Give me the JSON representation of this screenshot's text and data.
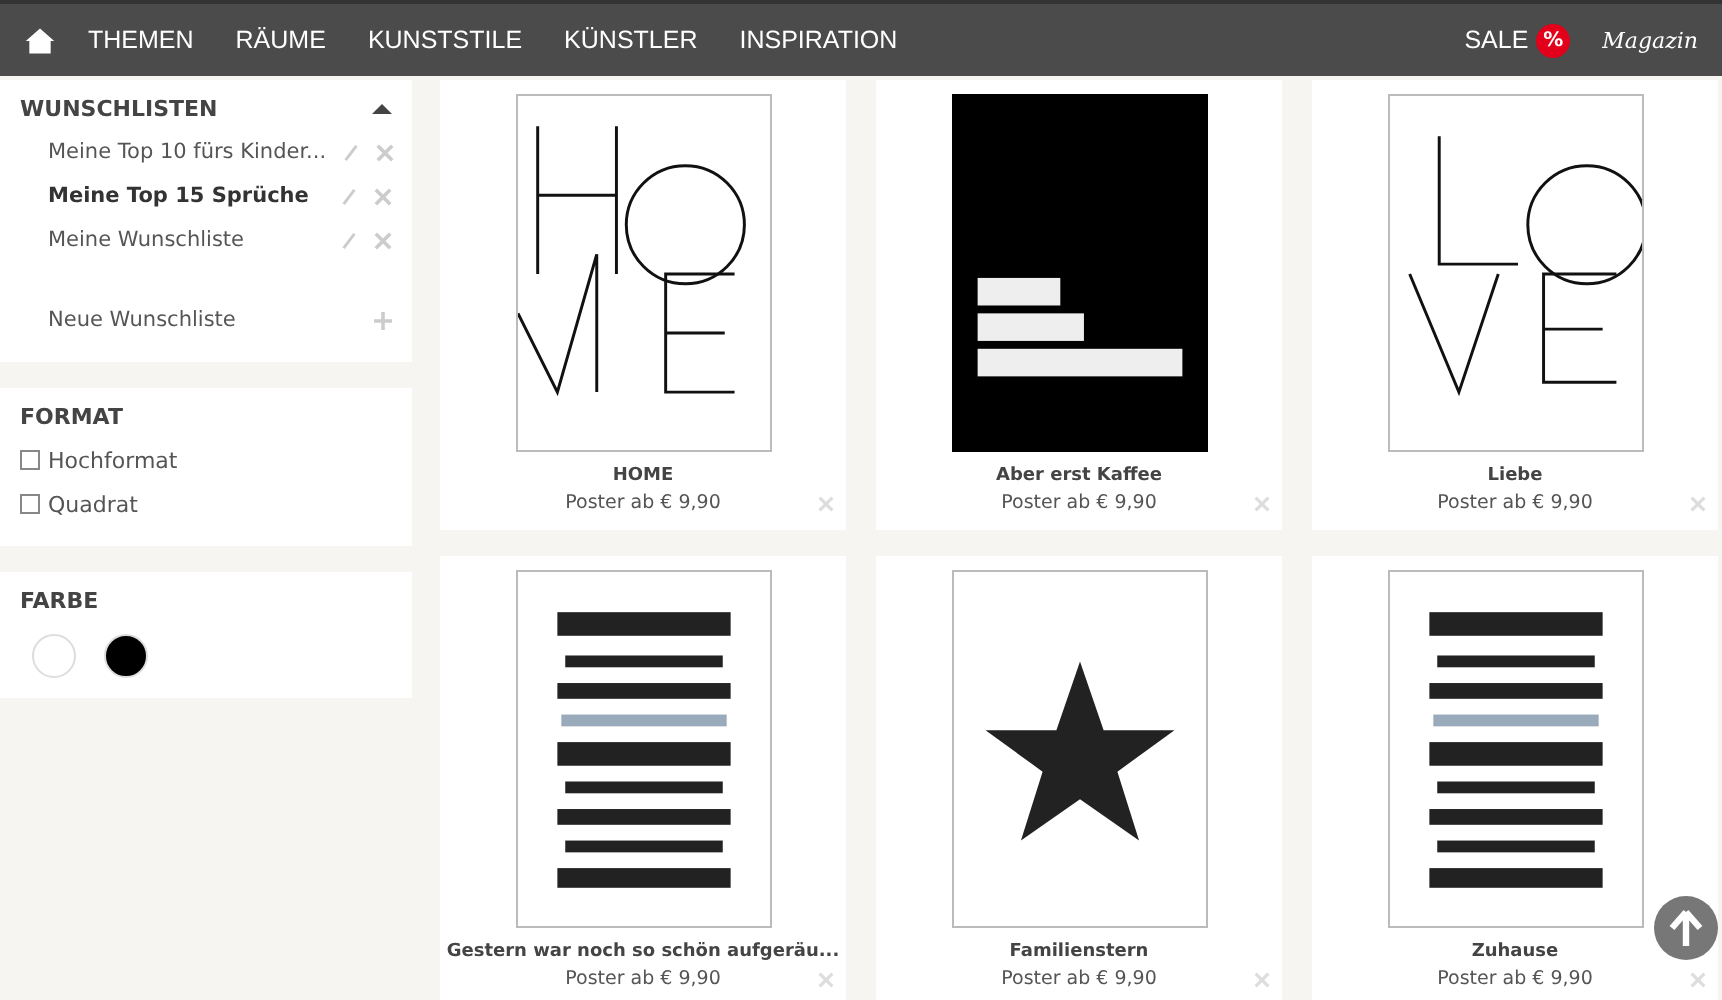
{
  "nav": {
    "items": [
      "THEMEN",
      "RÄUME",
      "KUNSTSTILE",
      "KÜNSTLER",
      "INSPIRATION"
    ],
    "sale": "SALE",
    "sale_badge": "%",
    "magazine": "Magazin"
  },
  "wishlists": {
    "title": "WUNSCHLISTEN",
    "expanded": true,
    "items": [
      {
        "label": "Meine Top 10 fürs Kinder...",
        "selected": false
      },
      {
        "label": "Meine Top 15 Sprüche",
        "selected": true
      },
      {
        "label": "Meine Wunschliste",
        "selected": false
      }
    ],
    "new_list": "Neue Wunschliste"
  },
  "format": {
    "title": "FORMAT",
    "options": [
      {
        "label": "Hochformat",
        "checked": false
      },
      {
        "label": "Quadrat",
        "checked": false
      }
    ]
  },
  "color_filter": {
    "title": "FARBE",
    "swatches": [
      {
        "color": "#ffffff",
        "selected": false
      },
      {
        "color": "#000000",
        "selected": false
      }
    ]
  },
  "products": [
    {
      "kind": "home",
      "title": "HOME",
      "price": "Poster ab € 9,90"
    },
    {
      "kind": "dark",
      "title": "Aber erst Kaffee",
      "price": "Poster ab € 9,90"
    },
    {
      "kind": "love",
      "title": "Liebe",
      "price": "Poster ab € 9,90"
    },
    {
      "kind": "lines",
      "title": "Gestern war noch so schön aufgeräu...",
      "price": "Poster ab € 9,90"
    },
    {
      "kind": "star",
      "title": "Familienstern",
      "price": "Poster ab € 9,90"
    },
    {
      "kind": "lines",
      "title": "Zuhause",
      "price": "Poster ab € 9,90"
    }
  ]
}
